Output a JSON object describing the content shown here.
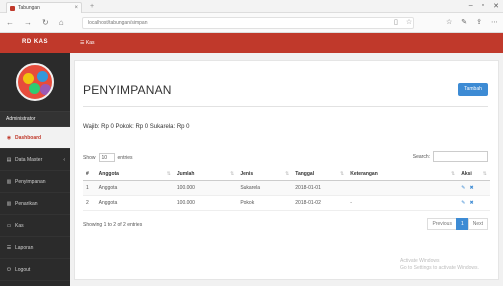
{
  "browser": {
    "tab_title": "Tabungan",
    "url": "localhost/tabungan/simpan",
    "new_tab": "+",
    "window_controls": [
      "–",
      "▫",
      "✕"
    ]
  },
  "app": {
    "brand": "RD KAS"
  },
  "sidebar": {
    "role": "Administrator",
    "items": [
      {
        "icon": "dashboard-icon",
        "glyph": "◉",
        "label": "Dashboard",
        "active": true
      },
      {
        "icon": "database-icon",
        "glyph": "▤",
        "label": "Data Master",
        "caret": "‹"
      },
      {
        "icon": "storage-icon",
        "glyph": "▥",
        "label": "Penyimpanan"
      },
      {
        "icon": "withdraw-icon",
        "glyph": "▥",
        "label": "Penarikan"
      },
      {
        "icon": "money-icon",
        "glyph": "▭",
        "label": "Kas"
      },
      {
        "icon": "report-icon",
        "glyph": "☰",
        "label": "Laporan"
      },
      {
        "icon": "logout-icon",
        "glyph": "⏻",
        "label": "Logout"
      }
    ]
  },
  "topbar": {
    "title": "☰ Kas"
  },
  "main": {
    "title": "PENYIMPANAN",
    "add_button": "Tambah",
    "saldo_text": "Wajib: Rp 0  Pokok: Rp 0  Sukarela: Rp 0",
    "show": {
      "label": "Show",
      "value": "10",
      "suffix": "entries"
    },
    "search_label": "Search:",
    "table": {
      "headers": [
        "#",
        "Anggota",
        "Jumlah",
        "Jenis",
        "Tanggal",
        "Keterangan",
        "Aksi"
      ],
      "rows": [
        {
          "no": "1",
          "anggota": "Anggota",
          "jumlah": "100.000",
          "jenis": "Sukarela",
          "tanggal": "2018-01-01",
          "keterangan": ""
        },
        {
          "no": "2",
          "anggota": "Anggota",
          "jumlah": "100.000",
          "jenis": "Pokok",
          "tanggal": "2018-01-02",
          "keterangan": "-"
        }
      ]
    },
    "info": "Showing 1 to 2 of 2 entries",
    "pager": {
      "prev": "Previous",
      "current": "1",
      "next": "Next"
    }
  },
  "watermark": [
    "Activate Windows",
    "Go to Settings to activate Windows."
  ],
  "colors": {
    "brand": "#c0392b",
    "sidebar": "#2b2b2b",
    "accent": "#3d8bd4"
  }
}
